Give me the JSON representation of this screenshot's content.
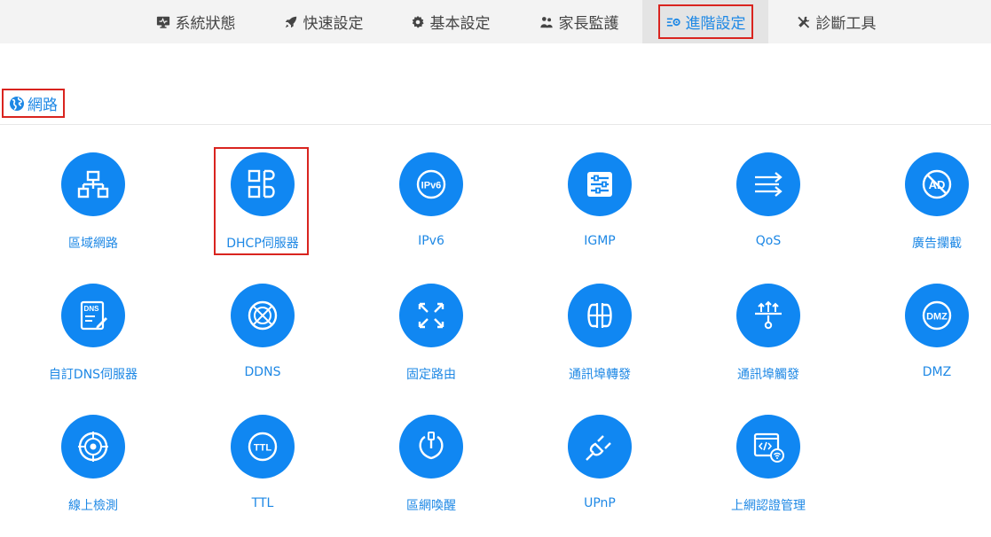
{
  "nav": {
    "items": [
      {
        "label": "系統狀態",
        "icon": "monitor-icon"
      },
      {
        "label": "快速設定",
        "icon": "rocket-icon"
      },
      {
        "label": "基本設定",
        "icon": "gear-icon"
      },
      {
        "label": "家長監護",
        "icon": "users-icon"
      },
      {
        "label": "進階設定",
        "icon": "advanced-settings-icon",
        "active": true
      },
      {
        "label": "診斷工具",
        "icon": "tools-icon"
      }
    ]
  },
  "section": {
    "title": "網路",
    "icon": "globe-icon"
  },
  "tiles": [
    {
      "label": "區域網路",
      "icon": "lan-network-icon"
    },
    {
      "label": "DHCP伺服器",
      "icon": "dhcp-icon"
    },
    {
      "label": "IPv6",
      "icon": "ipv6-icon"
    },
    {
      "label": "IGMP",
      "icon": "igmp-icon"
    },
    {
      "label": "QoS",
      "icon": "qos-icon"
    },
    {
      "label": "廣告攔截",
      "icon": "ad-block-icon"
    },
    {
      "label": "自訂DNS伺服器",
      "icon": "dns-icon"
    },
    {
      "label": "DDNS",
      "icon": "ddns-icon"
    },
    {
      "label": "固定路由",
      "icon": "static-route-icon"
    },
    {
      "label": "通訊埠轉發",
      "icon": "port-forward-icon"
    },
    {
      "label": "通訊埠觸發",
      "icon": "port-trigger-icon"
    },
    {
      "label": "DMZ",
      "icon": "dmz-icon"
    },
    {
      "label": "線上檢測",
      "icon": "online-detect-icon"
    },
    {
      "label": "TTL",
      "icon": "ttl-icon"
    },
    {
      "label": "區網喚醒",
      "icon": "wake-on-lan-icon"
    },
    {
      "label": "UPnP",
      "icon": "upnp-icon"
    },
    {
      "label": "上網認證管理",
      "icon": "web-auth-icon"
    }
  ],
  "colors": {
    "accent": "#1087f2",
    "text_accent": "#1e88e5",
    "highlight": "#d9241f",
    "nav_bg": "#f3f3f3"
  }
}
